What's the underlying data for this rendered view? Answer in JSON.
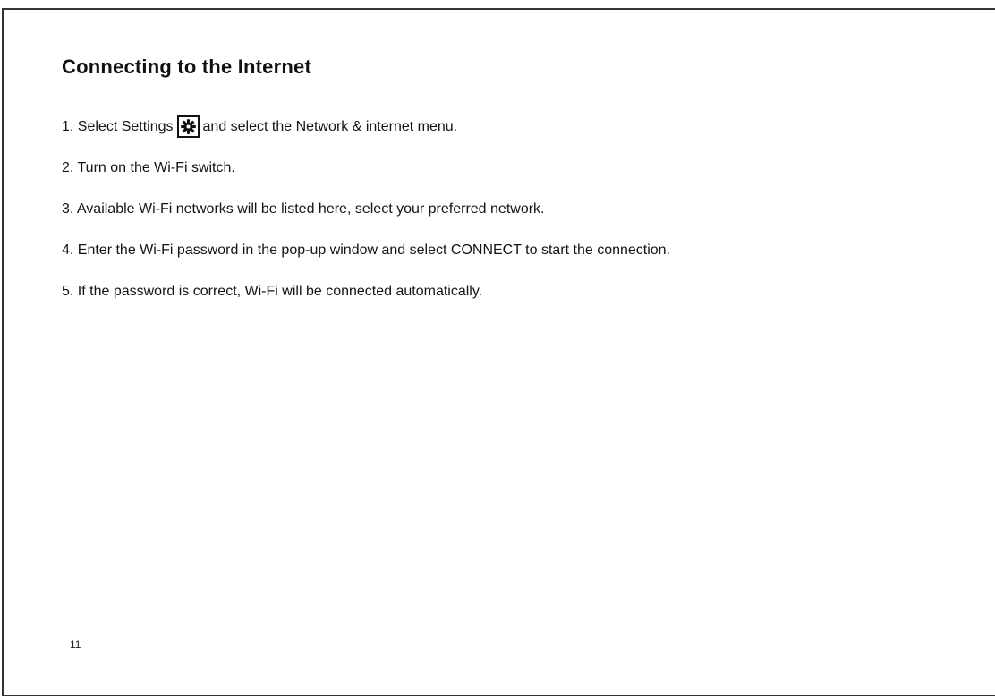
{
  "title": "Connecting to the Internet",
  "steps": [
    {
      "before_icon": "1. Select Settings",
      "icon": "gear-icon",
      "after_icon": "and select the Network & internet menu."
    },
    {
      "text": "2. Turn on the Wi-Fi switch."
    },
    {
      "text": "3. Available Wi-Fi networks will be listed here, select your preferred network."
    },
    {
      "text": "4. Enter the Wi-Fi password in the pop-up window and select CONNECT to start the connection."
    },
    {
      "text": "5. If the password is correct, Wi-Fi will be connected automatically."
    }
  ],
  "page_number": "11"
}
